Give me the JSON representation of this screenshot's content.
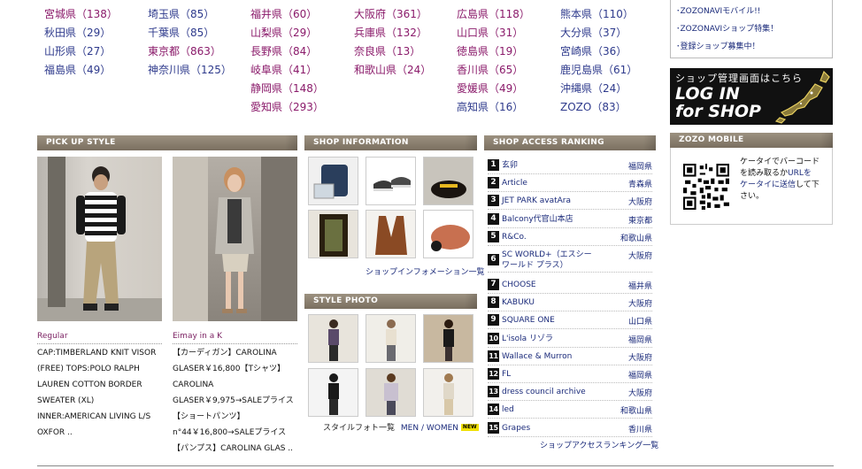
{
  "prefectures": [
    {
      "col": 0,
      "items": [
        {
          "label": "宮城県（138）",
          "color": "c2"
        },
        {
          "label": "秋田県（29）",
          "color": "c1"
        },
        {
          "label": "山形県（27）",
          "color": "c1"
        },
        {
          "label": "福島県（49）",
          "color": "c1"
        }
      ]
    },
    {
      "col": 1,
      "items": [
        {
          "label": "埼玉県（85）",
          "color": "c1"
        },
        {
          "label": "千葉県（85）",
          "color": "c1"
        },
        {
          "label": "東京都（863）",
          "color": "c2"
        },
        {
          "label": "神奈川県（125）",
          "color": "c1"
        }
      ]
    },
    {
      "col": 2,
      "items": [
        {
          "label": "福井県（60）",
          "color": "c2"
        },
        {
          "label": "山梨県（29）",
          "color": "c2"
        },
        {
          "label": "長野県（84）",
          "color": "c2"
        },
        {
          "label": "岐阜県（41）",
          "color": "c2"
        },
        {
          "label": "静岡県（148）",
          "color": "c2"
        },
        {
          "label": "愛知県（293）",
          "color": "c2"
        }
      ]
    },
    {
      "col": 3,
      "items": [
        {
          "label": "大阪府（361）",
          "color": "c2"
        },
        {
          "label": "兵庫県（132）",
          "color": "c2"
        },
        {
          "label": "奈良県（13）",
          "color": "c2"
        },
        {
          "label": "和歌山県（24）",
          "color": "c2"
        }
      ]
    },
    {
      "col": 4,
      "items": [
        {
          "label": "広島県（118）",
          "color": "c2"
        },
        {
          "label": "山口県（31）",
          "color": "c2"
        },
        {
          "label": "徳島県（19）",
          "color": "c2"
        },
        {
          "label": "香川県（65）",
          "color": "c2"
        },
        {
          "label": "愛媛県（49）",
          "color": "c2"
        },
        {
          "label": "高知県（16）",
          "color": "c1"
        }
      ]
    },
    {
      "col": 5,
      "items": [
        {
          "label": "熊本県（110）",
          "color": "c1"
        },
        {
          "label": "大分県（37）",
          "color": "c1"
        },
        {
          "label": "宮崎県（36）",
          "color": "c1"
        },
        {
          "label": "鹿児島県（61）",
          "color": "c1"
        },
        {
          "label": "沖縄県（24）",
          "color": "c1"
        },
        {
          "label": "ZOZO（83）",
          "color": "c1"
        }
      ]
    }
  ],
  "news": [
    "･ZOZONAVIモバイル!!",
    "･ZOZONAVIショップ特集！",
    "･登録ショップ募集中！"
  ],
  "login_banner": {
    "top": "ショップ管理画面はこちら",
    "line1": "LOG IN",
    "line2": "for SHOP"
  },
  "sections": {
    "pickup": "PICK UP STYLE",
    "shop_info": "SHOP INFORMATION",
    "ranking": "SHOP ACCESS RANKING",
    "style_photo": "STYLE PHOTO",
    "mobile": "ZOZO MOBILE"
  },
  "pickup": [
    {
      "shop": "Regular",
      "lines": [
        "CAP:TIMBERLAND KNIT VISOR",
        "(FREE) TOPS:POLO RALPH",
        "LAUREN  COTTON BORDER",
        "SWEATER (XL)",
        "INNER:AMERICAN LIVING  L/S",
        "OXFOR .."
      ]
    },
    {
      "shop": "Eimay in a K",
      "lines": [
        "【カーディガン】CAROLINA",
        "GLASER￥16,800【Tシャツ】",
        "CAROLINA",
        "GLASER￥9,975→SALEプライス",
        "【ショートパンツ】",
        "n°44￥16,800→SALEプライス",
        "【パンプス】CAROLINA GLAS .."
      ]
    }
  ],
  "shop_info_link": "ショップインフォメーション一覧",
  "style_photo_link": "スタイルフォト一覧",
  "style_photo_men": "MEN",
  "style_photo_sep": "/",
  "style_photo_women": "WOMEN",
  "new_badge": "NEW",
  "ranking": [
    {
      "num": "1",
      "name": "玄卯",
      "pref": "福岡県"
    },
    {
      "num": "2",
      "name": "Article",
      "pref": "青森県"
    },
    {
      "num": "3",
      "name": "JET PARK avatAra",
      "pref": "大阪府"
    },
    {
      "num": "4",
      "name": "Balcony代官山本店",
      "pref": "東京都"
    },
    {
      "num": "5",
      "name": "R&Co.",
      "pref": "和歌山県"
    },
    {
      "num": "6",
      "name": "SC WORLD+（エスシー",
      "name2": "ワールド プラス）",
      "pref": "大阪府"
    },
    {
      "num": "7",
      "name": "CHOOSE",
      "pref": "福井県"
    },
    {
      "num": "8",
      "name": "KABUKU",
      "pref": "大阪府"
    },
    {
      "num": "9",
      "name": "SQUARE ONE",
      "pref": "山口県"
    },
    {
      "num": "10",
      "name": "L'isola  リゾラ",
      "pref": "福岡県"
    },
    {
      "num": "11",
      "name": "Wallace & Murron",
      "pref": "大阪府"
    },
    {
      "num": "12",
      "name": "FL",
      "pref": "福岡県"
    },
    {
      "num": "13",
      "name": "dress council archive",
      "pref": "大阪府"
    },
    {
      "num": "14",
      "name": "led",
      "pref": "和歌山県"
    },
    {
      "num": "15",
      "name": "Grapes",
      "pref": "香川県"
    }
  ],
  "ranking_link": "ショップアクセスランキング一覧",
  "mobile": {
    "line1": "ケータイでバーコード",
    "line2a": "を読み取るか",
    "line2b": "URLを",
    "line3a": "ケータイに送信",
    "line3b": "して下",
    "line4": "さい。"
  }
}
